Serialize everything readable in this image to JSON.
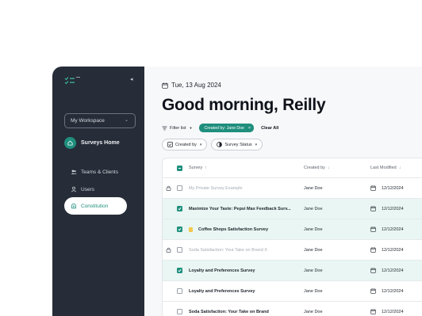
{
  "sidebar": {
    "logo_icon": "checklist-logo-icon",
    "collapse_icon": "chevron-left-icon",
    "workspace": "My Workspace",
    "home": "Surveys Home",
    "nav": [
      {
        "label": "Teams & Clients",
        "icon": "users-icon"
      },
      {
        "label": "Users",
        "icon": "user-icon"
      },
      {
        "label": "Constitution",
        "icon": "constitution-icon"
      }
    ]
  },
  "main": {
    "date": "Tue, 13 Aug 2024",
    "greeting": "Good morning, Reilly",
    "filters": {
      "filter_list": "Filter list",
      "chip": "Created by: Jane Doe",
      "clear": "Clear All"
    },
    "pills": {
      "created_by": "Created by",
      "status": "Survey Status"
    },
    "table": {
      "headers": {
        "survey": "Survey",
        "created_by": "Created by",
        "modified": "Last Modified"
      },
      "rows": [
        {
          "name": "My Private Survey Example",
          "by": "Jane Doe",
          "date": "12/12/2024",
          "locked": true,
          "checked": false,
          "faded": true
        },
        {
          "name": "Maximize Your Taste: Pepsi Max Feedback Surv...",
          "by": "Jane Doe",
          "date": "12/12/2024",
          "locked": false,
          "checked": true,
          "faded": false
        },
        {
          "name": "Coffee Shops Satisfaction Survey",
          "by": "Jane Doe",
          "date": "12/12/2024",
          "locked": false,
          "checked": true,
          "faded": false,
          "flag": true
        },
        {
          "name": "Soda Satisfaction: Your Take on Brand X",
          "by": "Jane Doe",
          "date": "12/12/2024",
          "locked": true,
          "checked": false,
          "faded": true
        },
        {
          "name": "Loyalty and Preferences Survey",
          "by": "Jane Doe",
          "date": "12/12/2024",
          "locked": false,
          "checked": true,
          "faded": false
        },
        {
          "name": "Loyalty and Preferences Survey",
          "by": "Jane Doe",
          "date": "12/12/2024",
          "locked": false,
          "checked": false,
          "faded": false
        },
        {
          "name": "Soda Satisfaction: Your Take on Brand",
          "by": "Jane Doe",
          "date": "12/12/2024",
          "locked": false,
          "checked": false,
          "faded": false
        }
      ]
    }
  },
  "colors": {
    "accent": "#1f8f7d",
    "sidebar": "#262d38",
    "selected_row": "#e9f6f3"
  }
}
